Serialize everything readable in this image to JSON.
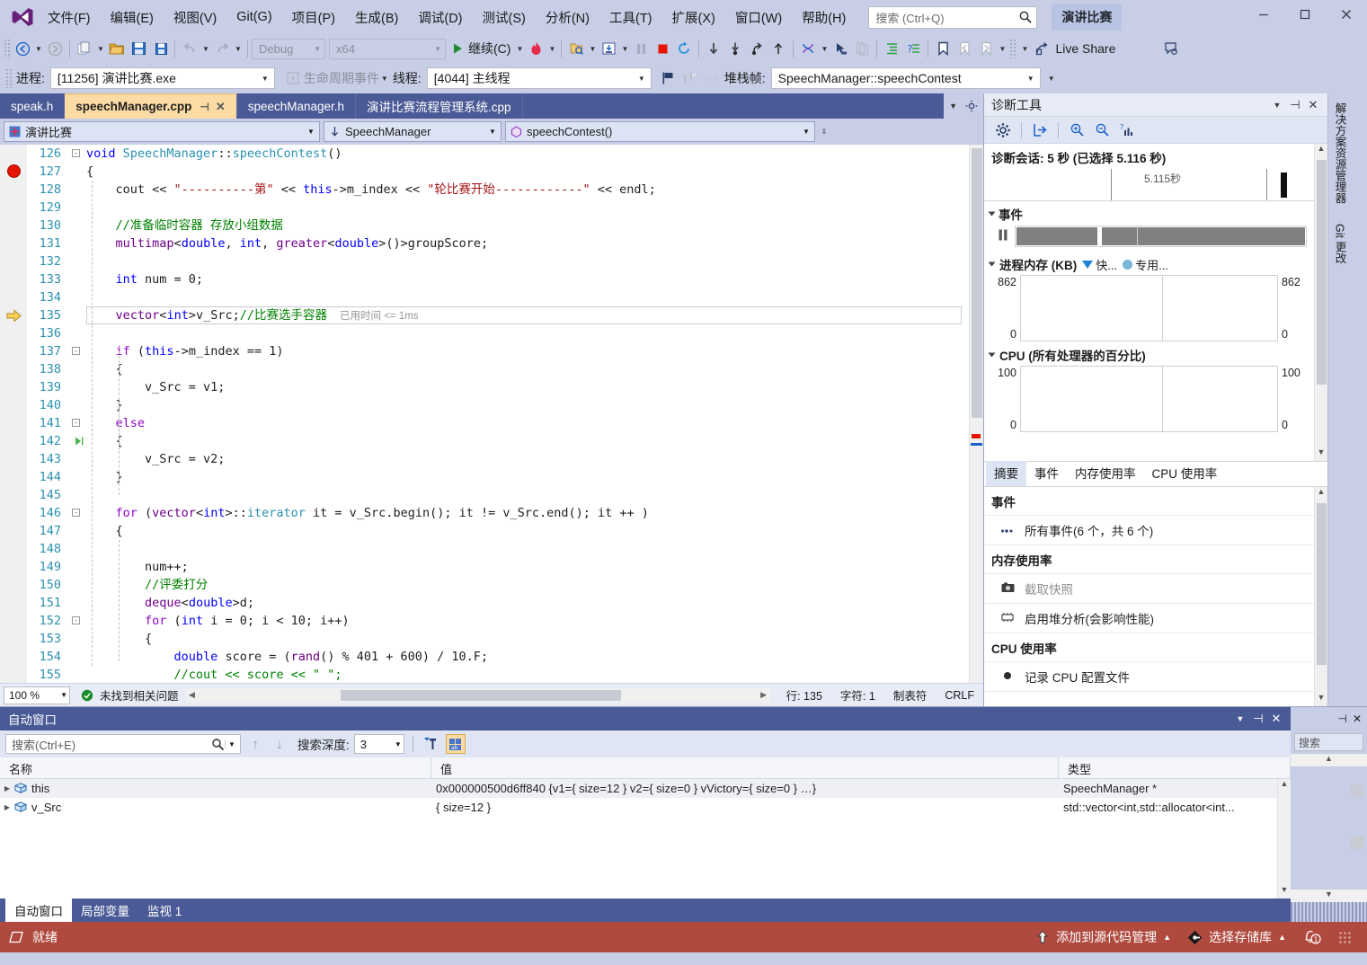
{
  "app": {
    "solution_chip": "演讲比赛",
    "search_placeholder": "搜索 (Ctrl+Q)"
  },
  "menu": [
    {
      "label": "文件(F)"
    },
    {
      "label": "编辑(E)"
    },
    {
      "label": "视图(V)"
    },
    {
      "label": "Git(G)"
    },
    {
      "label": "项目(P)"
    },
    {
      "label": "生成(B)"
    },
    {
      "label": "调试(D)"
    },
    {
      "label": "测试(S)"
    },
    {
      "label": "分析(N)"
    },
    {
      "label": "工具(T)"
    },
    {
      "label": "扩展(X)"
    },
    {
      "label": "窗口(W)"
    },
    {
      "label": "帮助(H)"
    }
  ],
  "toolbar": {
    "config": "Debug",
    "platform": "x64",
    "continue_label": "继续(C)",
    "live_share": "Live Share"
  },
  "debugbar": {
    "process_label": "进程:",
    "process_value": "[11256] 演讲比赛.exe",
    "lifecycle_label": "生命周期事件",
    "thread_label": "线程:",
    "thread_value": "[4044] 主线程",
    "stackframe_label": "堆栈帧:",
    "stackframe_value": "SpeechManager::speechContest"
  },
  "editor": {
    "tabs": [
      {
        "label": "speak.h",
        "active": false
      },
      {
        "label": "speechManager.cpp",
        "active": true
      },
      {
        "label": "speechManager.h",
        "active": false
      },
      {
        "label": "演讲比赛流程管理系统.cpp",
        "active": false
      }
    ],
    "nav": {
      "project": "演讲比赛",
      "class": "SpeechManager",
      "member": "speechContest()"
    },
    "elapsed_tip": "已用时间 <= 1ms",
    "lines": [
      {
        "n": "126",
        "tokens": [
          [
            "kw",
            "void "
          ],
          [
            "typ",
            "SpeechManager"
          ],
          [
            "pln",
            "::"
          ],
          [
            "typ",
            "speechContest"
          ],
          [
            "pln",
            "()"
          ]
        ]
      },
      {
        "n": "127",
        "tokens": [
          [
            "pln",
            "{"
          ]
        ]
      },
      {
        "n": "128",
        "tokens": [
          [
            "pln",
            "    cout "
          ],
          [
            "pln",
            "<< "
          ],
          [
            "str",
            "\"----------第\""
          ],
          [
            "pln",
            " << "
          ],
          [
            "kw",
            "this"
          ],
          [
            "pln",
            "->m_index << "
          ],
          [
            "str",
            "\"轮比赛开始------------\""
          ],
          [
            "pln",
            " << endl;"
          ]
        ]
      },
      {
        "n": "129",
        "tokens": [
          [
            "pln",
            ""
          ]
        ]
      },
      {
        "n": "130",
        "tokens": [
          [
            "cmt",
            "    //准备临时容器 存放小组数据"
          ]
        ]
      },
      {
        "n": "131",
        "tokens": [
          [
            "pln",
            "    "
          ],
          [
            "mac",
            "multimap"
          ],
          [
            "pln",
            "<"
          ],
          [
            "kw",
            "double"
          ],
          [
            "pln",
            ", "
          ],
          [
            "kw",
            "int"
          ],
          [
            "pln",
            ", "
          ],
          [
            "mac",
            "greater"
          ],
          [
            "pln",
            "<"
          ],
          [
            "kw",
            "double"
          ],
          [
            "pln",
            ">()>groupScore;"
          ]
        ]
      },
      {
        "n": "132",
        "tokens": [
          [
            "pln",
            ""
          ]
        ]
      },
      {
        "n": "133",
        "tokens": [
          [
            "pln",
            "    "
          ],
          [
            "kw",
            "int"
          ],
          [
            "pln",
            " num = 0;"
          ]
        ]
      },
      {
        "n": "134",
        "tokens": [
          [
            "pln",
            ""
          ]
        ]
      },
      {
        "n": "135",
        "tokens": [
          [
            "pln",
            "    "
          ],
          [
            "mac",
            "vector"
          ],
          [
            "pln",
            "<"
          ],
          [
            "kw",
            "int"
          ],
          [
            "pln",
            ">v_Src;"
          ],
          [
            "cmt",
            "//比赛选手容器"
          ]
        ]
      },
      {
        "n": "136",
        "tokens": [
          [
            "pln",
            ""
          ]
        ]
      },
      {
        "n": "137",
        "tokens": [
          [
            "pln",
            "    "
          ],
          [
            "kwp",
            "if"
          ],
          [
            "pln",
            " ("
          ],
          [
            "kw",
            "this"
          ],
          [
            "pln",
            "->m_index == 1)"
          ]
        ]
      },
      {
        "n": "138",
        "tokens": [
          [
            "pln",
            "    {"
          ]
        ]
      },
      {
        "n": "139",
        "tokens": [
          [
            "pln",
            "        v_Src = v1;"
          ]
        ]
      },
      {
        "n": "140",
        "tokens": [
          [
            "pln",
            "    }"
          ]
        ]
      },
      {
        "n": "141",
        "tokens": [
          [
            "pln",
            "    "
          ],
          [
            "kwp",
            "else"
          ]
        ]
      },
      {
        "n": "142",
        "tokens": [
          [
            "pln",
            "    {"
          ]
        ]
      },
      {
        "n": "143",
        "tokens": [
          [
            "pln",
            "        v_Src = v2;"
          ]
        ]
      },
      {
        "n": "144",
        "tokens": [
          [
            "pln",
            "    }"
          ]
        ]
      },
      {
        "n": "145",
        "tokens": [
          [
            "pln",
            ""
          ]
        ]
      },
      {
        "n": "146",
        "tokens": [
          [
            "pln",
            "    "
          ],
          [
            "kwp",
            "for"
          ],
          [
            "pln",
            " ("
          ],
          [
            "mac",
            "vector"
          ],
          [
            "pln",
            "<"
          ],
          [
            "kw",
            "int"
          ],
          [
            "pln",
            ">::"
          ],
          [
            "typ",
            "iterator"
          ],
          [
            "pln",
            " it = v_Src.begin(); it != v_Src.end(); it ++ )"
          ]
        ]
      },
      {
        "n": "147",
        "tokens": [
          [
            "pln",
            "    {"
          ]
        ]
      },
      {
        "n": "148",
        "tokens": [
          [
            "pln",
            ""
          ]
        ]
      },
      {
        "n": "149",
        "tokens": [
          [
            "pln",
            "        num++;"
          ]
        ]
      },
      {
        "n": "150",
        "tokens": [
          [
            "cmt",
            "        //评委打分"
          ]
        ]
      },
      {
        "n": "151",
        "tokens": [
          [
            "pln",
            "        "
          ],
          [
            "mac",
            "deque"
          ],
          [
            "pln",
            "<"
          ],
          [
            "kw",
            "double"
          ],
          [
            "pln",
            ">d;"
          ]
        ]
      },
      {
        "n": "152",
        "tokens": [
          [
            "pln",
            "        "
          ],
          [
            "kwp",
            "for"
          ],
          [
            "pln",
            " ("
          ],
          [
            "kw",
            "int"
          ],
          [
            "pln",
            " i = 0; i < 10; i++)"
          ]
        ]
      },
      {
        "n": "153",
        "tokens": [
          [
            "pln",
            "        {"
          ]
        ]
      },
      {
        "n": "154",
        "tokens": [
          [
            "pln",
            "            "
          ],
          [
            "kw",
            "double"
          ],
          [
            "pln",
            " score = ("
          ],
          [
            "mac",
            "rand"
          ],
          [
            "pln",
            "() % 401 + 600) / 10.F;"
          ]
        ]
      },
      {
        "n": "155",
        "tokens": [
          [
            "cmt",
            "            //cout << score << \" \";"
          ]
        ]
      }
    ],
    "status": {
      "zoom": "100 %",
      "problems": "未找到相关问题",
      "line": "行: 135",
      "col": "字符: 1",
      "tabs": "制表符",
      "eol": "CRLF"
    }
  },
  "diagnostics": {
    "title": "诊断工具",
    "session": "诊断会话: 5 秒 (已选择 5.116 秒)",
    "ruler_label": "5.115秒",
    "events_header": "事件",
    "memory_header": "进程内存 (KB)",
    "memory_legend_snapshot": "快...",
    "memory_legend_private": "专用...",
    "memory_max": "862",
    "memory_min": "0",
    "cpu_header": "CPU (所有处理器的百分比)",
    "cpu_max": "100",
    "cpu_min": "0",
    "tabs": [
      {
        "label": "摘要",
        "active": true
      },
      {
        "label": "事件",
        "active": false
      },
      {
        "label": "内存使用率",
        "active": false
      },
      {
        "label": "CPU 使用率",
        "active": false
      }
    ],
    "summary": {
      "events_group": "事件",
      "events_item": "所有事件(6 个，共 6 个)",
      "memory_group": "内存使用率",
      "memory_snapshot": "截取快照",
      "memory_heap": "启用堆分析(会影响性能)",
      "cpu_group": "CPU 使用率",
      "cpu_record": "记录 CPU 配置文件"
    }
  },
  "right_dock": [
    {
      "label": "解决方案资源管理器"
    },
    {
      "label": "Git 更改"
    }
  ],
  "autos": {
    "title": "自动窗口",
    "search_placeholder": "搜索(Ctrl+E)",
    "depth_label": "搜索深度:",
    "depth_value": "3",
    "columns": [
      "名称",
      "值",
      "类型"
    ],
    "rows": [
      {
        "name": "this",
        "value": "0x000000500d6ff840 {v1={ size=12 } v2={ size=0 } vVictory={ size=0 } …}",
        "type": "SpeechManager *"
      },
      {
        "name": "v_Src",
        "value": "{ size=12 }",
        "type": "std::vector<int,std::allocator<int..."
      }
    ],
    "tabs": [
      {
        "label": "自动窗口",
        "active": true
      },
      {
        "label": "局部变量",
        "active": false
      },
      {
        "label": "监视 1",
        "active": false
      }
    ],
    "side_search": "搜索"
  },
  "statusbar": {
    "state": "就绪",
    "source_control": "添加到源代码管理",
    "repository": "选择存储库",
    "notifications": "1"
  }
}
